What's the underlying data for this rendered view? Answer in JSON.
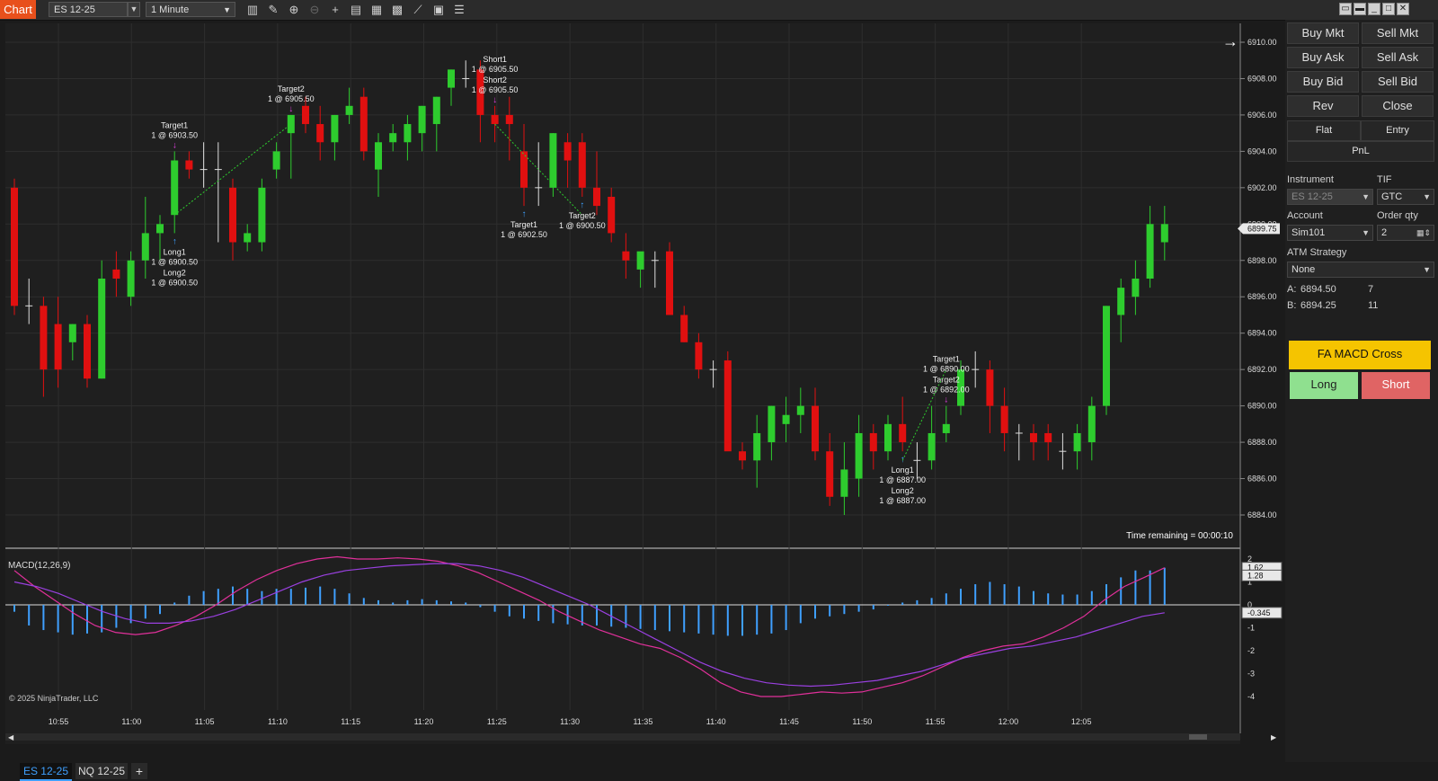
{
  "toolbar": {
    "chart_label": "Chart",
    "instrument": "ES 12-25",
    "interval": "1 Minute",
    "icons": [
      "bars-icon",
      "pencil-icon",
      "zoom-in-icon",
      "zoom-out-icon",
      "crosshair-icon",
      "properties-icon",
      "templates-icon",
      "indicators-icon",
      "strategies-icon",
      "data-box-icon",
      "list-icon"
    ]
  },
  "chart": {
    "time_remaining": "Time remaining = 00:00:10",
    "copyright": "© 2025 NinjaTrader, LLC",
    "price_ticks": [
      "6910.00",
      "6908.00",
      "6906.00",
      "6904.00",
      "6902.00",
      "6900.00",
      "6898.00",
      "6896.00",
      "6894.00",
      "6892.00",
      "6890.00",
      "6888.00",
      "6886.00",
      "6884.00"
    ],
    "current_price": "6899.75",
    "time_ticks": [
      "10:55",
      "11:00",
      "11:05",
      "11:10",
      "11:15",
      "11:20",
      "11:25",
      "11:30",
      "11:35",
      "11:40",
      "11:45",
      "11:50",
      "11:55",
      "12:00",
      "12:05"
    ],
    "colors": {
      "up": "#2ecc2e",
      "down": "#e01010",
      "doji": "#dddddd",
      "background": "#1f1f1f"
    },
    "markers": [
      {
        "title": "Target1",
        "price": "1 @ 6903.50",
        "kind": "exit",
        "bar": 11
      },
      {
        "title": "Long1",
        "price": "1 @ 6900.50",
        "kind": "entry",
        "bar": 11
      },
      {
        "title": "Long2",
        "price": "1 @ 6900.50",
        "kind": "entry",
        "bar": 11
      },
      {
        "title": "Target2",
        "price": "1 @ 6905.50",
        "kind": "exit",
        "bar": 19
      },
      {
        "title": "Short1",
        "price": "1 @ 6905.50",
        "kind": "entry",
        "bar": 33
      },
      {
        "title": "Short2",
        "price": "1 @ 6905.50",
        "kind": "entry",
        "bar": 33
      },
      {
        "title": "Target1",
        "price": "1 @ 6902.50",
        "kind": "exit",
        "bar": 35
      },
      {
        "title": "Target2",
        "price": "1 @ 6900.50",
        "kind": "exit",
        "bar": 39
      },
      {
        "title": "Long1",
        "price": "1 @ 6887.00",
        "kind": "entry",
        "bar": 61
      },
      {
        "title": "Long2",
        "price": "1 @ 6887.00",
        "kind": "entry",
        "bar": 61
      },
      {
        "title": "Target1",
        "price": "1 @ 6890.00",
        "kind": "exit",
        "bar": 64
      },
      {
        "title": "Target2",
        "price": "1 @ 6892.00",
        "kind": "exit",
        "bar": 64
      }
    ]
  },
  "chart_data": [
    {
      "type": "candlestick",
      "title": "ES 12-25",
      "interval": "1 Minute",
      "ylim": [
        6883,
        6911
      ],
      "candles": [
        [
          6902.0,
          6902.5,
          6895.0,
          6895.5
        ],
        [
          6895.5,
          6897.0,
          6894.5,
          6895.5
        ],
        [
          6895.5,
          6896.0,
          6890.5,
          6892.0
        ],
        [
          6894.5,
          6896.0,
          6891.0,
          6892.0
        ],
        [
          6893.5,
          6894.5,
          6892.5,
          6894.5
        ],
        [
          6894.5,
          6895.0,
          6891.0,
          6891.5
        ],
        [
          6891.5,
          6898.0,
          6891.5,
          6897.0
        ],
        [
          6897.5,
          6898.5,
          6896.0,
          6897.0
        ],
        [
          6896.0,
          6898.5,
          6895.5,
          6898.0
        ],
        [
          6898.0,
          6901.5,
          6897.0,
          6899.5
        ],
        [
          6899.5,
          6900.5,
          6898.0,
          6900.0
        ],
        [
          6900.5,
          6904.0,
          6899.5,
          6903.5
        ],
        [
          6903.5,
          6904.0,
          6902.5,
          6903.0
        ],
        [
          6903.0,
          6904.5,
          6902.0,
          6903.0
        ],
        [
          6903.0,
          6904.5,
          6899.0,
          6903.0
        ],
        [
          6902.0,
          6902.5,
          6898.0,
          6899.0
        ],
        [
          6899.0,
          6900.0,
          6898.5,
          6899.5
        ],
        [
          6899.0,
          6902.5,
          6898.5,
          6902.0
        ],
        [
          6903.0,
          6904.5,
          6902.5,
          6904.0
        ],
        [
          6905.0,
          6906.0,
          6902.5,
          6906.0
        ],
        [
          6906.5,
          6907.0,
          6905.0,
          6905.5
        ],
        [
          6905.5,
          6906.5,
          6903.5,
          6904.5
        ],
        [
          6904.5,
          6906.0,
          6903.5,
          6906.0
        ],
        [
          6906.0,
          6907.5,
          6905.5,
          6906.5
        ],
        [
          6907.0,
          6907.5,
          6903.5,
          6904.0
        ],
        [
          6903.0,
          6905.0,
          6901.5,
          6904.5
        ],
        [
          6904.5,
          6905.5,
          6904.0,
          6905.0
        ],
        [
          6904.5,
          6906.0,
          6903.5,
          6905.5
        ],
        [
          6905.0,
          6906.5,
          6904.0,
          6906.5
        ],
        [
          6905.5,
          6907.0,
          6904.0,
          6907.0
        ],
        [
          6907.5,
          6908.5,
          6906.5,
          6908.5
        ],
        [
          6908.0,
          6909.0,
          6907.5,
          6908.0
        ],
        [
          6908.5,
          6909.0,
          6904.5,
          6906.0
        ],
        [
          6906.0,
          6906.5,
          6904.5,
          6905.5
        ],
        [
          6906.0,
          6907.0,
          6903.5,
          6905.5
        ],
        [
          6904.0,
          6905.5,
          6901.0,
          6902.0
        ],
        [
          6902.0,
          6904.5,
          6901.0,
          6902.0
        ],
        [
          6902.0,
          6905.0,
          6901.5,
          6905.0
        ],
        [
          6904.5,
          6905.0,
          6902.0,
          6903.5
        ],
        [
          6904.5,
          6905.0,
          6901.5,
          6902.0
        ],
        [
          6902.0,
          6904.0,
          6900.5,
          6901.0
        ],
        [
          6901.5,
          6902.0,
          6899.0,
          6899.5
        ],
        [
          6898.5,
          6899.5,
          6897.0,
          6898.0
        ],
        [
          6897.5,
          6898.0,
          6896.5,
          6898.5
        ],
        [
          6898.0,
          6898.5,
          6896.5,
          6898.0
        ],
        [
          6898.5,
          6899.0,
          6895.0,
          6895.0
        ],
        [
          6895.0,
          6895.5,
          6893.5,
          6893.5
        ],
        [
          6893.5,
          6894.0,
          6891.5,
          6892.0
        ],
        [
          6892.0,
          6892.5,
          6891.0,
          6892.0
        ],
        [
          6892.5,
          6893.0,
          6888.0,
          6887.5
        ],
        [
          6887.5,
          6888.0,
          6886.5,
          6887.0
        ],
        [
          6887.0,
          6889.5,
          6885.5,
          6888.5
        ],
        [
          6888.0,
          6890.0,
          6887.0,
          6890.0
        ],
        [
          6889.0,
          6890.5,
          6888.0,
          6889.5
        ],
        [
          6889.5,
          6891.0,
          6888.5,
          6890.0
        ],
        [
          6890.0,
          6891.0,
          6887.0,
          6887.5
        ],
        [
          6887.5,
          6888.5,
          6884.5,
          6885.0
        ],
        [
          6885.0,
          6888.0,
          6884.0,
          6886.5
        ],
        [
          6886.0,
          6889.5,
          6885.0,
          6888.5
        ],
        [
          6888.5,
          6889.0,
          6886.5,
          6887.5
        ],
        [
          6887.5,
          6889.5,
          6887.0,
          6889.0
        ],
        [
          6889.0,
          6890.5,
          6887.5,
          6888.0
        ],
        [
          6887.0,
          6888.0,
          6886.0,
          6887.0
        ],
        [
          6887.0,
          6890.0,
          6886.5,
          6888.5
        ],
        [
          6888.5,
          6890.0,
          6888.0,
          6889.0
        ],
        [
          6890.0,
          6892.5,
          6889.5,
          6892.0
        ],
        [
          6892.0,
          6893.0,
          6891.0,
          6892.0
        ],
        [
          6892.0,
          6892.5,
          6888.5,
          6890.0
        ],
        [
          6890.0,
          6891.0,
          6887.5,
          6888.5
        ],
        [
          6888.5,
          6889.0,
          6887.0,
          6888.5
        ],
        [
          6888.5,
          6889.0,
          6887.0,
          6888.0
        ],
        [
          6888.5,
          6889.0,
          6887.0,
          6888.0
        ],
        [
          6887.5,
          6888.5,
          6886.5,
          6887.5
        ],
        [
          6887.5,
          6889.0,
          6886.5,
          6888.5
        ],
        [
          6888.0,
          6890.5,
          6887.0,
          6890.0
        ],
        [
          6890.0,
          6895.5,
          6889.5,
          6895.5
        ],
        [
          6895.0,
          6897.0,
          6893.5,
          6896.5
        ],
        [
          6896.0,
          6898.0,
          6895.0,
          6897.0
        ],
        [
          6897.0,
          6901.0,
          6896.5,
          6900.0
        ],
        [
          6899.0,
          6901.0,
          6898.0,
          6900.0
        ]
      ]
    },
    {
      "type": "bar",
      "title": "MACD(12,26,9)",
      "ylim": [
        -4.5,
        2.5
      ],
      "y_ticks": [
        "2",
        "1",
        "0",
        "-1",
        "-2",
        "-3",
        "-4"
      ],
      "value_labels": [
        "1.62",
        "1.28",
        "-0.345"
      ],
      "series": [
        {
          "name": "histogram",
          "values": [
            -0.3,
            -0.9,
            -1.1,
            -1.2,
            -1.3,
            -1.25,
            -1.2,
            -1.0,
            -0.8,
            -0.6,
            -0.4,
            0.1,
            0.4,
            0.6,
            0.7,
            0.8,
            0.7,
            0.6,
            0.7,
            0.7,
            0.75,
            0.8,
            0.7,
            0.5,
            0.3,
            0.2,
            0.1,
            0.2,
            0.25,
            0.2,
            0.15,
            0.1,
            -0.1,
            -0.3,
            -0.5,
            -0.6,
            -0.7,
            -0.8,
            -0.85,
            -0.9,
            -0.9,
            -0.95,
            -1.0,
            -1.05,
            -1.1,
            -1.15,
            -1.2,
            -1.25,
            -1.3,
            -1.35,
            -1.35,
            -1.3,
            -1.25,
            -1.1,
            -0.8,
            -0.6,
            -0.5,
            -0.4,
            -0.3,
            -0.2,
            0.0,
            0.1,
            0.2,
            0.3,
            0.5,
            0.7,
            0.9,
            1.0,
            0.9,
            0.8,
            0.6,
            0.5,
            0.45,
            0.45,
            0.6,
            0.9,
            1.2,
            1.5,
            1.5,
            1.62
          ]
        },
        {
          "name": "macd",
          "values": [
            1.5,
            0.8,
            0.2,
            -0.4,
            -0.9,
            -1.2,
            -1.3,
            -1.2,
            -0.9,
            -0.5,
            0.0,
            0.6,
            1.1,
            1.5,
            1.8,
            2.0,
            2.1,
            2.0,
            2.0,
            2.05,
            2.0,
            1.9,
            1.7,
            1.4,
            1.0,
            0.6,
            0.2,
            -0.3,
            -0.7,
            -1.1,
            -1.4,
            -1.7,
            -1.9,
            -2.3,
            -2.8,
            -3.4,
            -3.8,
            -4.0,
            -4.0,
            -3.9,
            -3.8,
            -3.85,
            -3.8,
            -3.6,
            -3.4,
            -3.1,
            -2.7,
            -2.3,
            -2.0,
            -1.8,
            -1.7,
            -1.4,
            -1.0,
            -0.5,
            0.2,
            0.8,
            1.2,
            1.62
          ]
        },
        {
          "name": "signal",
          "values": [
            1.0,
            0.8,
            0.5,
            0.1,
            -0.3,
            -0.6,
            -0.8,
            -0.8,
            -0.7,
            -0.5,
            -0.2,
            0.2,
            0.6,
            1.0,
            1.3,
            1.5,
            1.6,
            1.7,
            1.75,
            1.8,
            1.8,
            1.7,
            1.5,
            1.2,
            0.8,
            0.4,
            0.0,
            -0.5,
            -1.0,
            -1.5,
            -2.0,
            -2.5,
            -2.9,
            -3.2,
            -3.4,
            -3.5,
            -3.55,
            -3.5,
            -3.4,
            -3.3,
            -3.1,
            -2.9,
            -2.6,
            -2.3,
            -2.1,
            -1.9,
            -1.8,
            -1.6,
            -1.4,
            -1.1,
            -0.8,
            -0.5,
            -0.345
          ]
        }
      ]
    }
  ],
  "panel": {
    "buttons": [
      {
        "name": "buy-mkt-button",
        "label": "Buy Mkt"
      },
      {
        "name": "sell-mkt-button",
        "label": "Sell Mkt"
      },
      {
        "name": "buy-ask-button",
        "label": "Buy Ask"
      },
      {
        "name": "sell-ask-button",
        "label": "Sell Ask"
      },
      {
        "name": "buy-bid-button",
        "label": "Buy Bid"
      },
      {
        "name": "sell-bid-button",
        "label": "Sell Bid"
      },
      {
        "name": "rev-button",
        "label": "Rev"
      },
      {
        "name": "close-button",
        "label": "Close"
      }
    ],
    "flat": "Flat",
    "entry": "Entry",
    "pnl": "PnL",
    "instrument_label": "Instrument",
    "instrument_value": "ES 12-25",
    "tif_label": "TIF",
    "tif_value": "GTC",
    "account_label": "Account",
    "account_value": "Sim101",
    "qty_label": "Order qty",
    "qty_value": "2",
    "atm_label": "ATM Strategy",
    "atm_value": "None",
    "ask_label": "A:",
    "ask_price": "6894.50",
    "ask_size": "7",
    "bid_label": "B:",
    "bid_price": "6894.25",
    "bid_size": "11",
    "strategy_label": "FA MACD Cross",
    "long_label": "Long",
    "short_label": "Short",
    "colors": {
      "strategy": "#f5c400",
      "long": "#8fe08f",
      "short": "#e06464"
    }
  },
  "tabs": [
    {
      "name": "tab-es",
      "label": "ES 12-25",
      "active": true
    },
    {
      "name": "tab-nq",
      "label": "NQ 12-25",
      "active": false
    }
  ],
  "add_tab": "+"
}
